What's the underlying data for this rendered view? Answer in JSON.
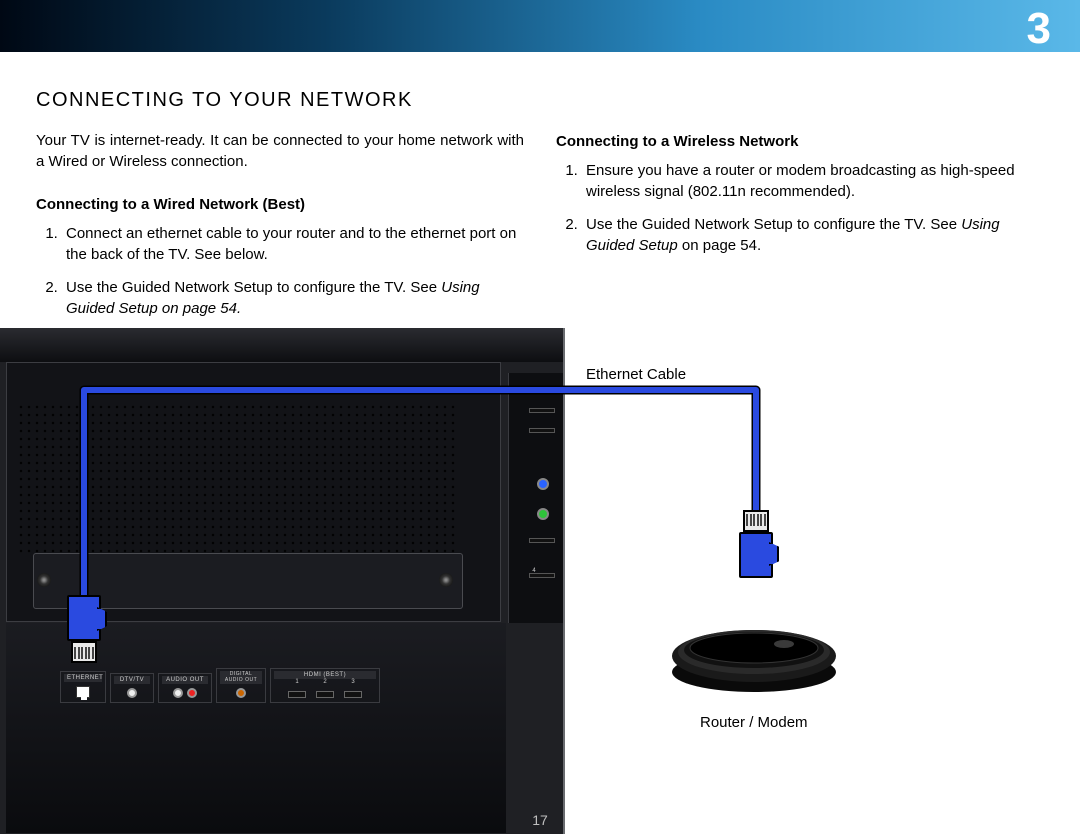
{
  "chapter_number": "3",
  "page_number": "17",
  "heading": "CONNECTING TO YOUR NETWORK",
  "intro": "Your TV is internet-ready. It can be connected to your home network with a Wired or Wireless connection.",
  "wired": {
    "title": "Connecting to a Wired Network (Best)",
    "step1": "Connect an ethernet cable to your router and to the ethernet port on the back of the TV. See below.",
    "step2_a": "Use the Guided Network Setup to configure the TV. See ",
    "step2_em": "Using Guided Setup on page 54."
  },
  "wireless": {
    "title": "Connecting to a Wireless Network",
    "step1": "Ensure you have a router or modem broadcasting as high-speed wireless signal (802.11n recommended).",
    "step2_a": "Use the Guided Network Setup to configure the TV. See ",
    "step2_em": "Using Guided Setup",
    "step2_b": " on page 54."
  },
  "diagram": {
    "ethernet_cable_label": "Ethernet Cable",
    "router_label": "Router / Modem",
    "ports": {
      "ethernet": "ETHERNET",
      "dtv": "DTV/TV",
      "audio_out": "AUDIO OUT",
      "digital_audio": "DIGITAL AUDIO OUT",
      "hdmi": "HDMI (BEST)",
      "hdmi_slot4": "4"
    }
  }
}
